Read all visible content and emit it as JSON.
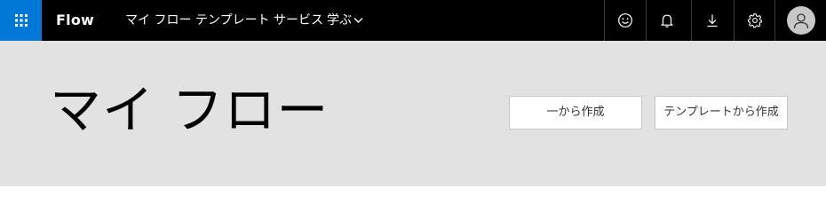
{
  "header": {
    "app_name": "Flow",
    "nav": [
      {
        "label": "マイ フロー"
      },
      {
        "label": "テンプレート"
      },
      {
        "label": "サービス"
      },
      {
        "label": "学ぶ"
      }
    ],
    "icons": [
      "app-launcher-icon",
      "smiley-icon",
      "bell-icon",
      "download-icon",
      "gear-icon",
      "avatar-icon"
    ]
  },
  "main": {
    "title": "マイ フロー",
    "buttons": {
      "create_blank": "一から作成",
      "create_from_template": "テンプレートから作成"
    }
  },
  "colors": {
    "topbar": "#000000",
    "launcher": "#0078d7",
    "hero": "#e2e2e2"
  }
}
